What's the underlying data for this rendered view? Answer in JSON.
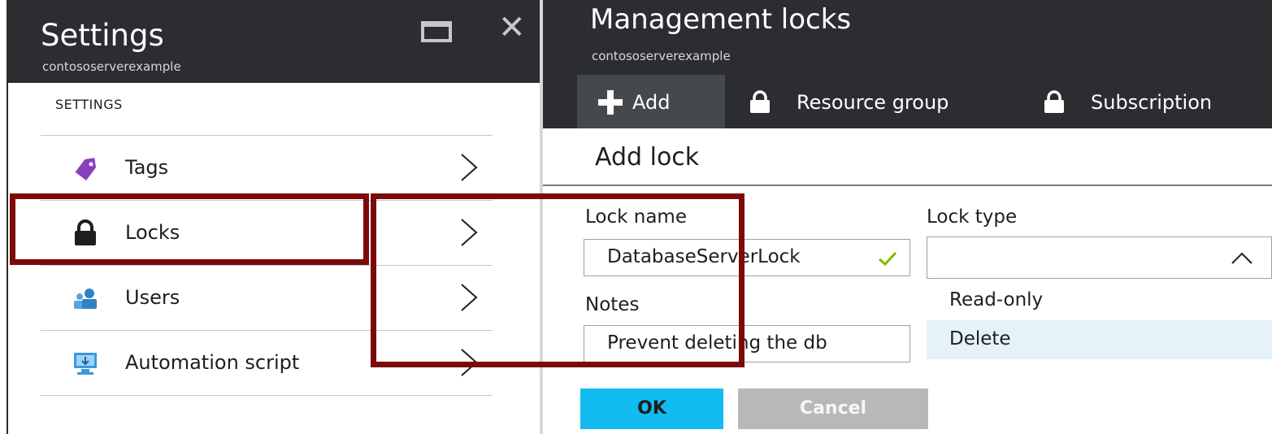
{
  "settings_blade": {
    "title": "Settings",
    "subtitle": "contososerverexample",
    "section_label": "SETTINGS",
    "items": [
      {
        "label": "Tags",
        "icon": "tag-icon"
      },
      {
        "label": "Locks",
        "icon": "lock-icon"
      },
      {
        "label": "Users",
        "icon": "users-icon"
      },
      {
        "label": "Automation script",
        "icon": "automation-script-icon"
      }
    ]
  },
  "locks_blade": {
    "title": "Management locks",
    "subtitle": "contososerverexample",
    "commands": [
      {
        "label": "Add",
        "icon": "plus-icon"
      },
      {
        "label": "Resource group",
        "icon": "lock-icon"
      },
      {
        "label": "Subscription",
        "icon": "lock-icon"
      }
    ],
    "form": {
      "title": "Add lock",
      "lock_name_label": "Lock name",
      "lock_name_value": "DatabaseServerLock",
      "notes_label": "Notes",
      "notes_value": "Prevent deleting the db",
      "lock_type_label": "Lock type",
      "lock_type_value": "",
      "lock_type_options": [
        "Read-only",
        "Delete"
      ],
      "ok_label": "OK",
      "cancel_label": "Cancel"
    }
  },
  "colors": {
    "header_bg": "#2b2d31",
    "accent_ok": "#12bcf0",
    "highlight_border": "#7b0b0b",
    "valid_check": "#7fba00",
    "tag_purple": "#8a3fbf"
  }
}
